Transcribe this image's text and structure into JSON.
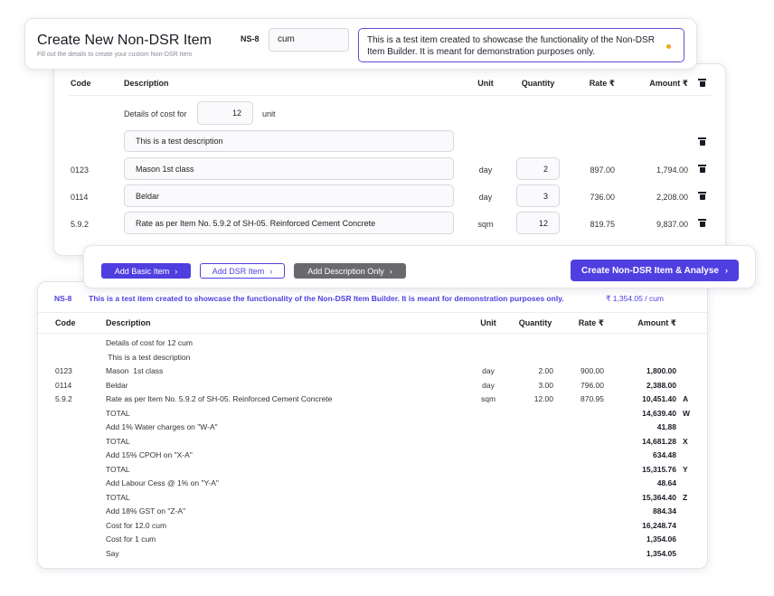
{
  "header": {
    "title": "Create New Non-DSR Item",
    "subtitle": "Fill out the details to create your custom Non-DSR Item",
    "code": "NS-8",
    "unit_value": "cum",
    "description_value": "This is a test item created to showcase the functionality of the Non-DSR Item Builder. It is meant for demonstration purposes only."
  },
  "builder": {
    "columns": {
      "code": "Code",
      "description": "Description",
      "unit": "Unit",
      "quantity": "Quantity",
      "rate": "Rate ₹",
      "amount": "Amount ₹"
    },
    "details_label": "Details of cost for",
    "details_qty": "12",
    "details_unit": "unit",
    "description_row": "This is a test description",
    "rows": [
      {
        "code": "0123",
        "description": "Mason  1st class",
        "unit": "day",
        "quantity": "2",
        "rate": "897.00",
        "amount": "1,794.00"
      },
      {
        "code": "0114",
        "description": "Beldar",
        "unit": "day",
        "quantity": "3",
        "rate": "736.00",
        "amount": "2,208.00"
      },
      {
        "code": "5.9.2",
        "description": "Rate as per Item No. 5.9.2 of SH-05. Reinforced Cement Concrete",
        "unit": "sqm",
        "quantity": "12",
        "rate": "819.75",
        "amount": "9,837.00"
      }
    ]
  },
  "actions": {
    "add_basic": "Add Basic Item",
    "add_dsr": "Add DSR Item",
    "add_description": "Add Description Only",
    "create": "Create Non-DSR Item & Analyse"
  },
  "analysis": {
    "code": "NS-8",
    "description": "This is a test item created to showcase the functionality of the Non-DSR Item Builder. It is meant for demonstration purposes only.",
    "rate_per_unit": "₹ 1,354.05 / cum",
    "columns": {
      "code": "Code",
      "description": "Description",
      "unit": "Unit",
      "quantity": "Quantity",
      "rate": "Rate ₹",
      "amount": "Amount ₹"
    },
    "rows": [
      {
        "code": "",
        "description": "Details of cost for 12 cum",
        "unit": "",
        "quantity": "",
        "rate": "",
        "amount": "",
        "mark": ""
      },
      {
        "code": "",
        "description": " This is a test description",
        "unit": "",
        "quantity": "",
        "rate": "",
        "amount": "",
        "mark": ""
      },
      {
        "code": "0123",
        "description": "Mason  1st class",
        "unit": "day",
        "quantity": "2.00",
        "rate": "900.00",
        "amount": "1,800.00",
        "mark": ""
      },
      {
        "code": "0114",
        "description": "Beldar",
        "unit": "day",
        "quantity": "3.00",
        "rate": "796.00",
        "amount": "2,388.00",
        "mark": ""
      },
      {
        "code": "5.9.2",
        "description": "Rate as per Item No. 5.9.2 of SH-05. Reinforced Cement Concrete",
        "unit": "sqm",
        "quantity": "12.00",
        "rate": "870.95",
        "amount": "10,451.40",
        "mark": "A"
      },
      {
        "code": "",
        "description": "TOTAL",
        "unit": "",
        "quantity": "",
        "rate": "",
        "amount": "14,639.40",
        "mark": "W"
      },
      {
        "code": "",
        "description": "Add 1% Water charges on \"W-A\"",
        "unit": "",
        "quantity": "",
        "rate": "",
        "amount": "41.88",
        "mark": ""
      },
      {
        "code": "",
        "description": "TOTAL",
        "unit": "",
        "quantity": "",
        "rate": "",
        "amount": "14,681.28",
        "mark": "X"
      },
      {
        "code": "",
        "description": "Add 15% CPOH on \"X-A\"",
        "unit": "",
        "quantity": "",
        "rate": "",
        "amount": "634.48",
        "mark": ""
      },
      {
        "code": "",
        "description": "TOTAL",
        "unit": "",
        "quantity": "",
        "rate": "",
        "amount": "15,315.76",
        "mark": "Y"
      },
      {
        "code": "",
        "description": "Add Labour Cess @ 1% on \"Y-A\"",
        "unit": "",
        "quantity": "",
        "rate": "",
        "amount": "48.64",
        "mark": ""
      },
      {
        "code": "",
        "description": "TOTAL",
        "unit": "",
        "quantity": "",
        "rate": "",
        "amount": "15,364.40",
        "mark": "Z"
      },
      {
        "code": "",
        "description": "Add 18% GST on \"Z-A\"",
        "unit": "",
        "quantity": "",
        "rate": "",
        "amount": "884.34",
        "mark": ""
      },
      {
        "code": "",
        "description": "Cost for 12.0 cum",
        "unit": "",
        "quantity": "",
        "rate": "",
        "amount": "16,248.74",
        "mark": ""
      },
      {
        "code": "",
        "description": "Cost for 1 cum",
        "unit": "",
        "quantity": "",
        "rate": "",
        "amount": "1,354.06",
        "mark": ""
      },
      {
        "code": "",
        "description": "Say",
        "unit": "",
        "quantity": "",
        "rate": "",
        "amount": "1,354.05",
        "mark": ""
      }
    ]
  },
  "icons": {
    "delete": "trash-icon",
    "chevron": "chevron-right-icon",
    "status_dot": "status-dot-icon"
  },
  "colors": {
    "accent": "#4f3fe0",
    "status_dot": "#f5a524",
    "button_grey": "#6a6a6e"
  }
}
